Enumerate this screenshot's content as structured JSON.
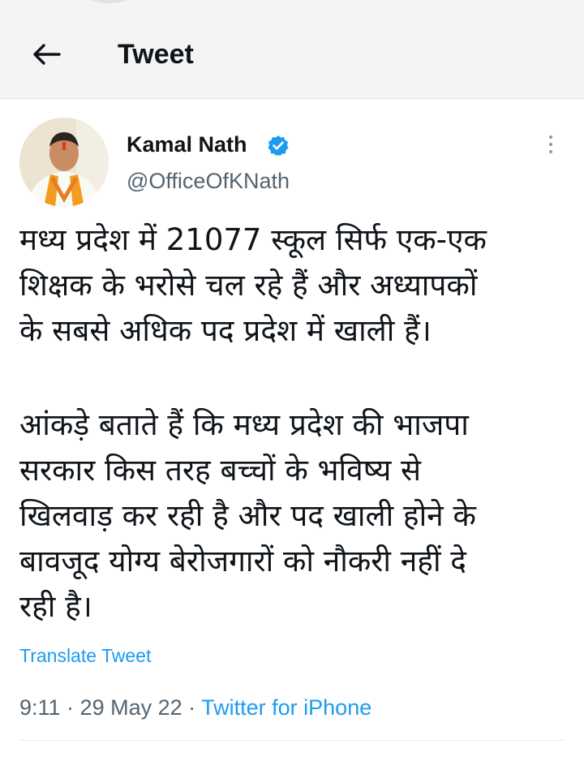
{
  "header": {
    "title": "Tweet",
    "back_icon": "arrow-left-icon"
  },
  "tweet": {
    "author": {
      "name": "Kamal Nath",
      "handle": "@OfficeOfKNath",
      "verified": true,
      "verified_color": "#1d9bf0"
    },
    "paragraph1_lines": [
      "मध्य प्रदेश में 21077 स्कूल सिर्फ एक-एक",
      "शिक्षक के भरोसे चल रहे हैं और अध्यापकों",
      "के सबसे अधिक पद प्रदेश में खाली हैं।"
    ],
    "paragraph2_lines": [
      "आंकड़े बताते हैं कि मध्य प्रदेश की भाजपा",
      "सरकार किस तरह बच्चों के भविष्य से",
      "खिलवाड़ कर रही है और पद खाली होने के",
      "बावजूद योग्य बेरोजगारों को नौकरी नहीं दे",
      "रही है।"
    ],
    "translate_label": "Translate Tweet",
    "meta": {
      "time": "9:11",
      "separator": " · ",
      "date": "29 May 22",
      "source": "Twitter for iPhone"
    }
  },
  "colors": {
    "accent": "#1d9bf0",
    "secondary_text": "#536471",
    "header_bg": "#f4f4f4"
  }
}
